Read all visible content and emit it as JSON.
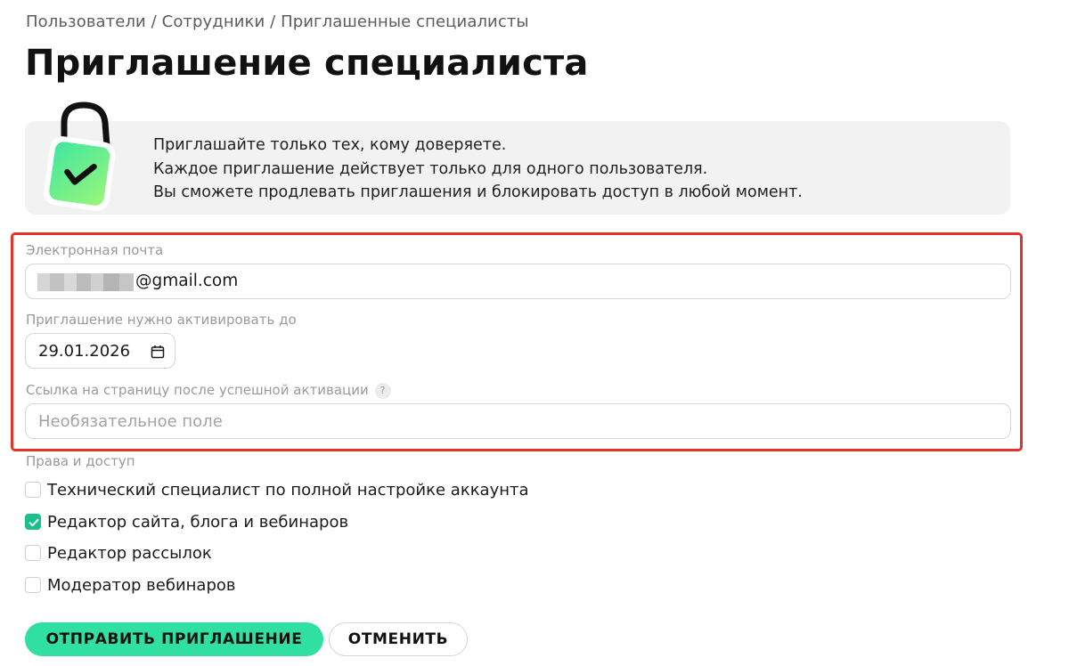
{
  "breadcrumb": {
    "text": "Пользователи / Сотрудники / Приглашенные специалисты"
  },
  "page": {
    "title": "Приглашение специалиста"
  },
  "info": {
    "lines": [
      "Приглашайте только тех, кому доверяете.",
      "Каждое приглашение действует только для одного пользователя.",
      "Вы сможете продлевать приглашения и блокировать доступ в любой момент."
    ]
  },
  "form": {
    "email": {
      "label": "Электронная почта",
      "value_visible": "@gmail.com"
    },
    "expiry": {
      "label": "Приглашение нужно активировать до",
      "value": "29.01.2026"
    },
    "redirect": {
      "label": "Ссылка на страницу после успешной активации",
      "help": "?",
      "placeholder": "Необязательное поле"
    },
    "permissions": {
      "label": "Права и доступ",
      "items": [
        {
          "label": "Технический специалист по полной настройке аккаунта",
          "checked": false
        },
        {
          "label": "Редактор сайта, блога и вебинаров",
          "checked": true
        },
        {
          "label": "Редактор рассылок",
          "checked": false
        },
        {
          "label": "Модератор вебинаров",
          "checked": false
        }
      ]
    }
  },
  "actions": {
    "submit_label": "ОТПРАВИТЬ ПРИГЛАШЕНИЕ",
    "cancel_label": "ОТМЕНИТЬ"
  },
  "icons": {
    "lock": "lock-check-icon",
    "calendar": "calendar-icon",
    "help": "question-icon",
    "checkmark": "checkmark-icon"
  },
  "colors": {
    "accent": "#2fe0a0",
    "checkbox_checked": "#19c08a",
    "highlight_frame": "#e0352b",
    "banner_bg": "#f2f2f2"
  }
}
